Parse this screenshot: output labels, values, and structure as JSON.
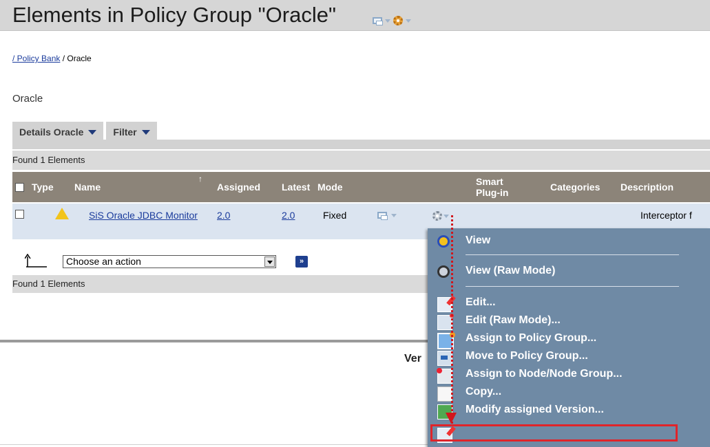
{
  "header": {
    "title": "Elements in Policy Group \"Oracle\""
  },
  "breadcrumb": {
    "link": "/ Policy Bank",
    "current": " / Oracle"
  },
  "section": {
    "heading": "Oracle"
  },
  "tabs": [
    {
      "label": "Details Oracle"
    },
    {
      "label": "Filter"
    }
  ],
  "table": {
    "found_top": "Found 1 Elements",
    "found_bottom": "Found 1 Elements",
    "columns": {
      "type": "Type",
      "name": "Name",
      "assigned": "Assigned",
      "latest": "Latest",
      "mode": "Mode",
      "smart_plugin": "Smart Plug-in",
      "categories": "Categories",
      "description": "Description"
    },
    "rows": [
      {
        "name": "SiS Oracle JDBC Monitor",
        "assigned": "2.0",
        "latest": "2.0",
        "mode": "Fixed",
        "description": "Interceptor f"
      }
    ]
  },
  "actions": {
    "select_value": "Choose an action",
    "go_label": "»"
  },
  "footer": {
    "text": "Ver"
  },
  "context_menu": {
    "items": [
      {
        "label": "View",
        "icon": "view-icon"
      },
      {
        "label": "View (Raw Mode)",
        "icon": "view-raw-icon"
      },
      {
        "label": "Edit...",
        "icon": "edit-icon"
      },
      {
        "label": "Edit (Raw Mode)...",
        "icon": "edit-raw-icon"
      },
      {
        "label": "Assign to Policy Group...",
        "icon": "assign-policy-icon"
      },
      {
        "label": "Move to Policy Group...",
        "icon": "move-policy-icon"
      },
      {
        "label": "Assign to Node/Node Group...",
        "icon": "assign-node-icon"
      },
      {
        "label": "Copy...",
        "icon": "copy-icon"
      },
      {
        "label": "Modify assigned Version...",
        "icon": "modify-version-icon"
      }
    ]
  },
  "colors": {
    "header_bg": "#d6d6d6",
    "table_header": "#8c8479",
    "row_bg": "#dbe4f0",
    "menu_bg": "#6f8aa5",
    "highlight": "#e0242a",
    "link": "#1a3b9c"
  }
}
